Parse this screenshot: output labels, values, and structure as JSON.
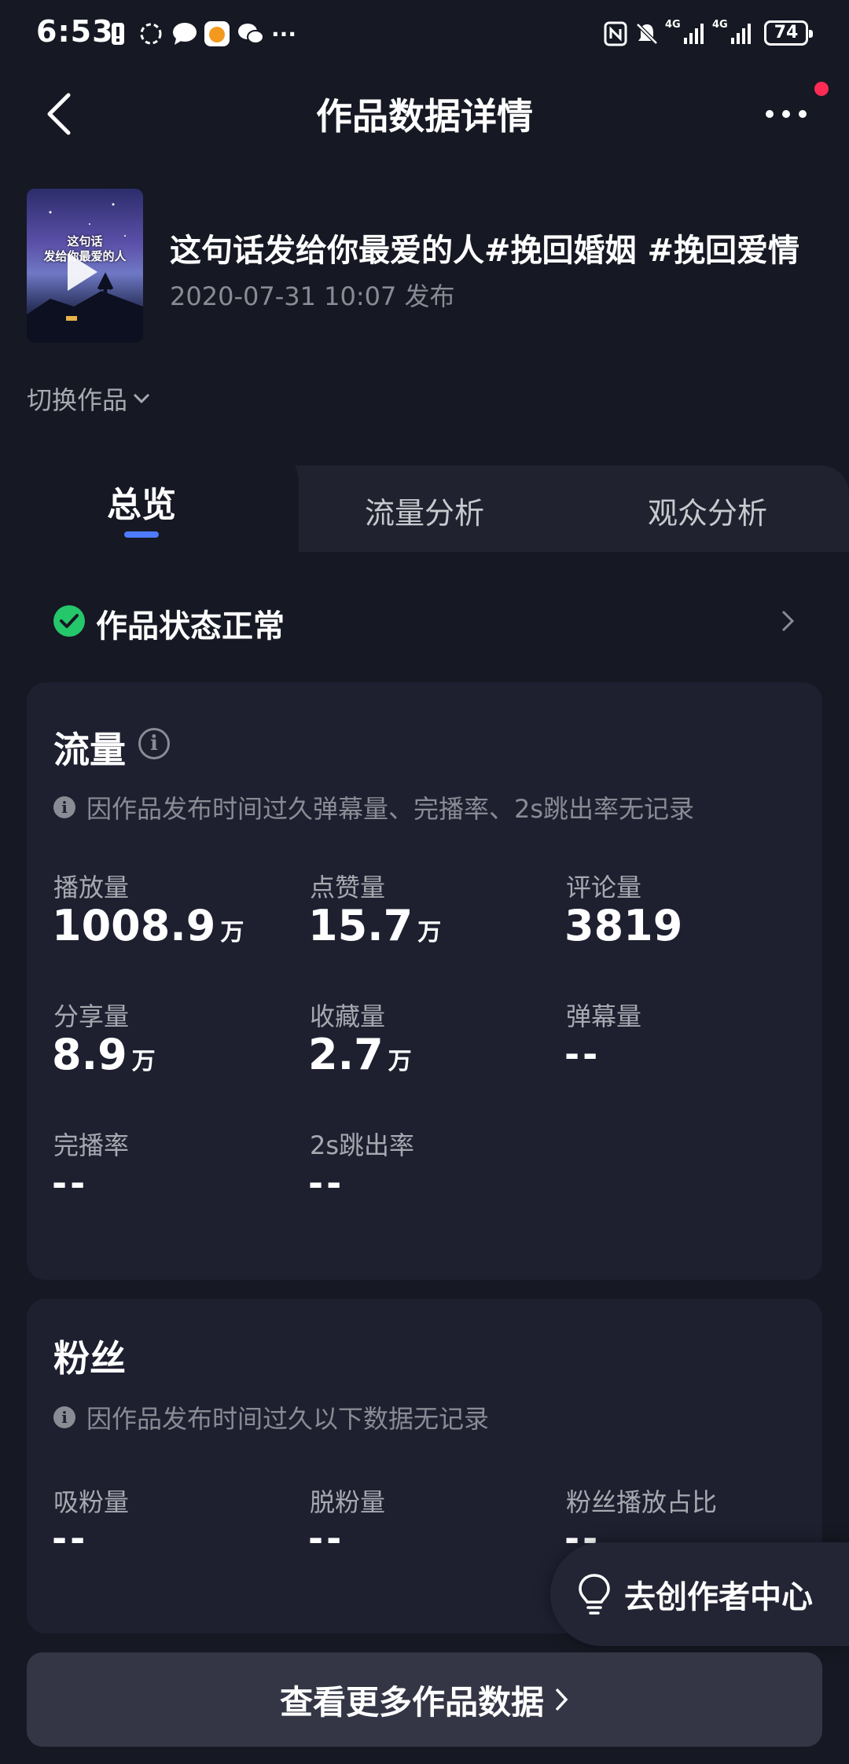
{
  "status_bar": {
    "time": "6:53",
    "network_1": "4G",
    "network_2": "4G",
    "battery": "74"
  },
  "header": {
    "title": "作品数据详情"
  },
  "video": {
    "thumbnail_text_line1": "这句话",
    "thumbnail_text_line2": "发给你最爱的人",
    "title": "这句话发给你最爱的人#挽回婚姻 #挽回爱情",
    "date": "2020-07-31 10:07 发布"
  },
  "switch_label": "切换作品",
  "tabs": [
    {
      "label": "总览",
      "active": true
    },
    {
      "label": "流量分析",
      "active": false
    },
    {
      "label": "观众分析",
      "active": false
    }
  ],
  "status": {
    "text": "作品状态正常",
    "color": "#25c76b"
  },
  "traffic": {
    "title": "流量",
    "note": "因作品发布时间过久弹幕量、完播率、2s跳出率无记录",
    "metrics": [
      {
        "label": "播放量",
        "value": "1008.9",
        "unit": "万"
      },
      {
        "label": "点赞量",
        "value": "15.7",
        "unit": "万"
      },
      {
        "label": "评论量",
        "value": "3819",
        "unit": ""
      },
      {
        "label": "分享量",
        "value": "8.9",
        "unit": "万"
      },
      {
        "label": "收藏量",
        "value": "2.7",
        "unit": "万"
      },
      {
        "label": "弹幕量",
        "value": "--",
        "unit": ""
      },
      {
        "label": "完播率",
        "value": "--",
        "unit": ""
      },
      {
        "label": "2s跳出率",
        "value": "--",
        "unit": ""
      }
    ]
  },
  "fans": {
    "title": "粉丝",
    "note": "因作品发布时间过久以下数据无记录",
    "metrics": [
      {
        "label": "吸粉量",
        "value": "--"
      },
      {
        "label": "脱粉量",
        "value": "--"
      },
      {
        "label": "粉丝播放占比",
        "value": "--"
      }
    ]
  },
  "creator_center": {
    "label": "去创作者中心"
  },
  "bottom_button": {
    "label": "查看更多作品数据"
  },
  "colors": {
    "background": "#161823",
    "card": "#1e2030",
    "accent": "#4e7bff",
    "notification": "#fe2c55"
  }
}
